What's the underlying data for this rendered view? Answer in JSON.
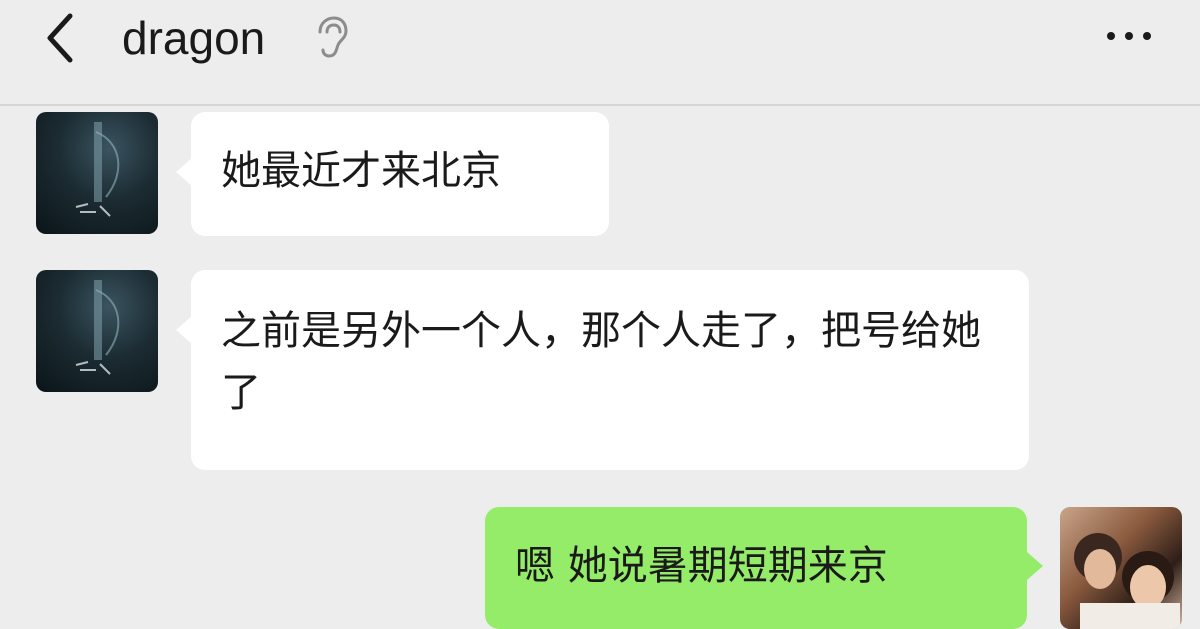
{
  "header": {
    "back_icon": "chevron-left-icon",
    "title": "dragon",
    "mute_icon": "ear-icon",
    "more_icon": "more-dots-icon"
  },
  "messages": [
    {
      "sender": "dragon",
      "direction": "incoming",
      "text": "她最近才来北京"
    },
    {
      "sender": "dragon",
      "direction": "incoming",
      "text": "之前是另外一个人，那个人走了，把号给她了"
    },
    {
      "sender": "self",
      "direction": "outgoing",
      "text": "嗯 她说暑期短期来京"
    }
  ],
  "colors": {
    "background": "#ededed",
    "incoming_bubble": "#ffffff",
    "outgoing_bubble": "#95ec69",
    "text": "#1a1a1a"
  }
}
